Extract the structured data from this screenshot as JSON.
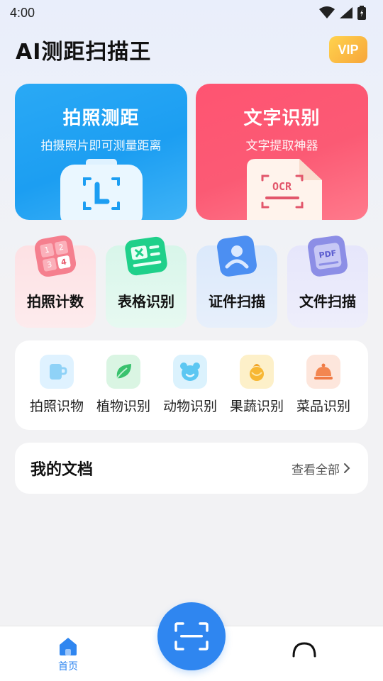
{
  "status_bar": {
    "time": "4:00"
  },
  "header": {
    "title": "AI测距扫描王",
    "vip_label": "VIP"
  },
  "feature_cards": [
    {
      "title": "拍照测距",
      "subtitle": "拍摄照片即可测量距离",
      "icon": "ruler-scan-icon",
      "color": "#1c9ef2"
    },
    {
      "title": "文字识别",
      "subtitle": "文字提取神器",
      "icon": "ocr-document-icon",
      "ocr_text": "OCR",
      "color": "#fb5a74"
    }
  ],
  "tools": [
    {
      "label": "拍照计数",
      "icon": "number-grid-icon",
      "digits": [
        "1",
        "2",
        "3",
        "4"
      ]
    },
    {
      "label": "表格识别",
      "icon": "spreadsheet-icon"
    },
    {
      "label": "证件扫描",
      "icon": "id-card-icon"
    },
    {
      "label": "文件扫描",
      "icon": "pdf-file-icon",
      "pdf_text": "PDF"
    }
  ],
  "recognizers": [
    {
      "label": "拍照识物",
      "icon": "cup-icon"
    },
    {
      "label": "植物识别",
      "icon": "leaf-icon"
    },
    {
      "label": "动物识别",
      "icon": "bear-icon"
    },
    {
      "label": "果蔬识别",
      "icon": "fruit-icon"
    },
    {
      "label": "菜品识别",
      "icon": "dish-cover-icon"
    }
  ],
  "documents": {
    "title": "我的文档",
    "view_all": "查看全部"
  },
  "bottom_nav": {
    "home_label": "首页",
    "accent": "#2f86f0"
  }
}
